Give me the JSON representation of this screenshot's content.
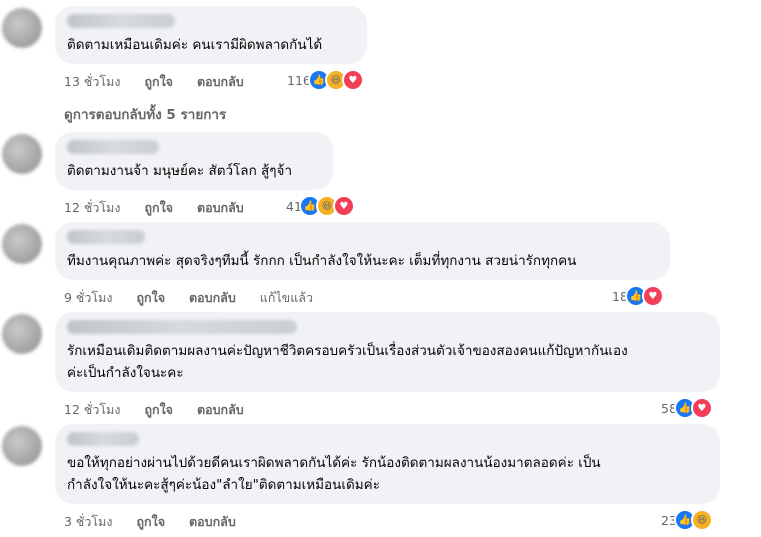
{
  "view_replies_label": "ดูการตอบกลับทั้ง 5 รายการ",
  "actions": {
    "like": "ถูกใจ",
    "reply": "ตอบกลับ",
    "edited": "แก้ไขแล้ว"
  },
  "comments": [
    {
      "text": "ติดตามเหมือนเดิมค่ะ คนเรามีผิดพลาดกันได้",
      "time": "13 ชั่วโมง",
      "reactions_count": "116",
      "reactions": [
        "like-icon",
        "haha-icon",
        "love-icon"
      ]
    },
    {
      "text": "ติดตามงานจ้า มนุษย์คะ สัตว์โลก สู้ๆจ้า",
      "time": "12 ชั่วโมง",
      "reactions_count": "41",
      "reactions": [
        "like-icon",
        "haha-icon",
        "love-icon"
      ]
    },
    {
      "text": "ทีมงานคุณภาพค่ะ สุดจริงๆทีมนี้ รักกก เป็นกำลังใจให้นะคะ เต็มที่ทุกงาน สวยน่ารักทุกคน",
      "time": "9 ชั่วโมง",
      "edited": true,
      "reactions_count": "18",
      "reactions": [
        "like-icon",
        "love-icon"
      ]
    },
    {
      "text": "รักเหมือนเดิมติดตามผลงานค่ะปัญหาชีวิตครอบครัวเป็นเรื่องส่วนตัวเจ้าของสองคนแก้ปัญหากันเอง\nค่ะเป็นกำลังใจนะคะ",
      "time": "12 ชั่วโมง",
      "reactions_count": "58",
      "reactions": [
        "like-icon",
        "love-icon"
      ]
    },
    {
      "text": "ขอให้ทุกอย่างผ่านไปด้วยดีคนเราผิดพลาดกันได้ค่ะ รักน้องติดตามผลงานน้องมาตลอดค่ะ เป็น\nกำลังใจให้นะคะสู้ๆค่ะน้อง\"ลำใย\"ติดตามเหมือนเดิมค่ะ",
      "time": "3 ชั่วโมง",
      "reactions_count": "23",
      "reactions": [
        "like-icon",
        "haha-icon"
      ]
    }
  ],
  "colors": {
    "bubble": "#f0f2f5",
    "meta": "#65676b",
    "like": "#1877f2",
    "love": "#f33e58",
    "haha": "#f7b125"
  }
}
